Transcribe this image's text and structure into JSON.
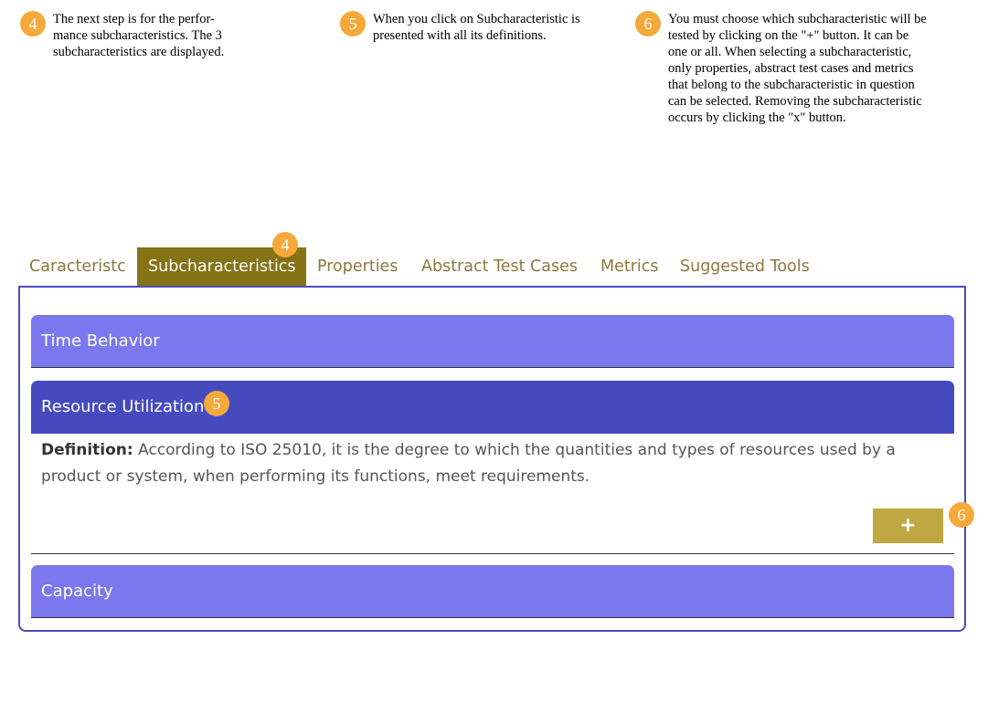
{
  "notes": [
    {
      "number": "4",
      "text_lines": [
        "The next step is for the perfor-",
        "mance subcharacteristics. The 3",
        "subcharacteristics are displayed."
      ]
    },
    {
      "number": "5",
      "text_lines": [
        "When you click on Subcharacteristic is",
        "presented with all its definitions."
      ]
    },
    {
      "number": "6",
      "text_lines": [
        "You must choose which subcharacteristic will be",
        "tested by clicking on the \"+\" button. It can be",
        "one or all. When selecting a subcharacteristic,",
        "only properties, abstract test cases and metrics",
        "that belong to the subcharacteristic in question",
        "can be selected.  Removing the subcharacteristic",
        "occurs by clicking the \"x\" button."
      ]
    }
  ],
  "tabs": [
    {
      "label": "Caracteristc"
    },
    {
      "label": "Subcharacteristics",
      "active": true
    },
    {
      "label": "Properties"
    },
    {
      "label": "Abstract Test Cases"
    },
    {
      "label": "Metrics"
    },
    {
      "label": "Suggested Tools"
    }
  ],
  "badges": {
    "tab": "4",
    "resource": "5",
    "add": "6"
  },
  "accordion": {
    "items": [
      {
        "title": "Time Behavior"
      },
      {
        "title": "Resource Utilization",
        "expanded": true
      },
      {
        "title": "Capacity"
      }
    ],
    "definition_label": "Definition:",
    "definition_text": " According to ISO 25010, it is the degree to which the quantities and types of resources used by a product or system, when performing its functions, meet requirements.",
    "add_label": "+"
  },
  "colors": {
    "tab_active": "#857316",
    "tab_text": "#8a7a3c",
    "accordion_collapsed": "#7b77ee",
    "accordion_expanded": "#454bbf",
    "add_button": "#bfa842",
    "badge": "#f5a93a",
    "panel_border": "#4c4cbd"
  }
}
